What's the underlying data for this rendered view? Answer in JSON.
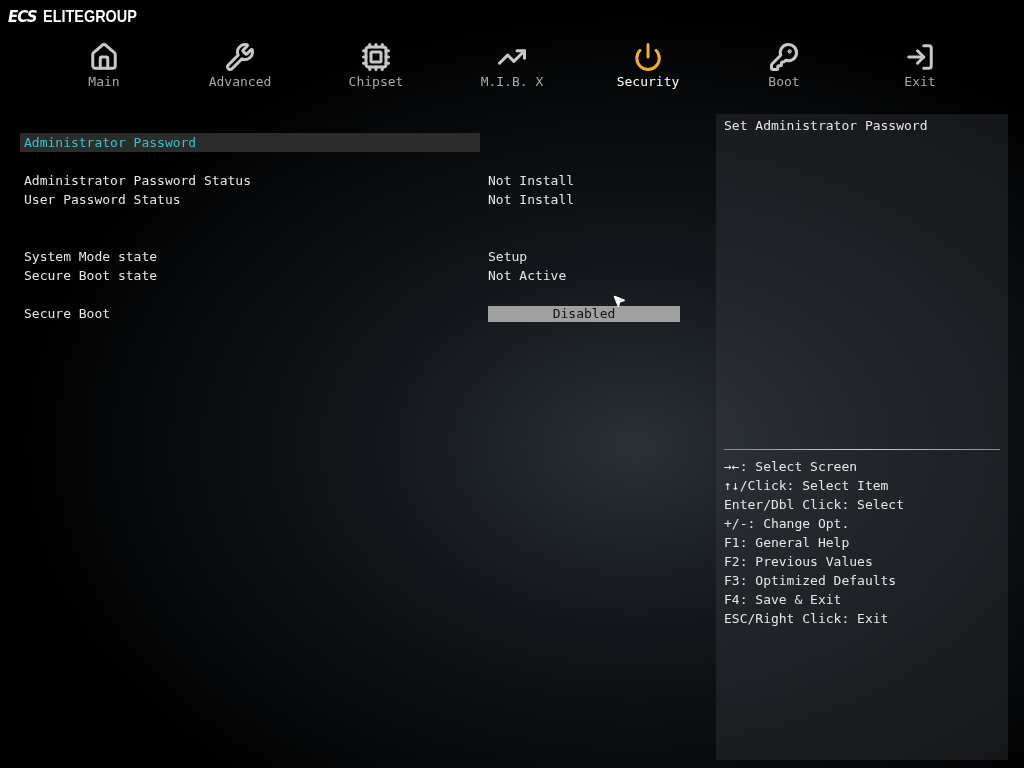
{
  "logo": {
    "mark": "ECS",
    "text": "ELITEGROUP"
  },
  "tabs": [
    {
      "label": "Main",
      "selected": false
    },
    {
      "label": "Advanced",
      "selected": false
    },
    {
      "label": "Chipset",
      "selected": false
    },
    {
      "label": "M.I.B. X",
      "selected": false
    },
    {
      "label": "Security",
      "selected": true
    },
    {
      "label": "Boot",
      "selected": false
    },
    {
      "label": "Exit",
      "selected": false
    }
  ],
  "items": [
    {
      "kind": "heading",
      "label": "Administrator Password",
      "selected": true
    },
    {
      "kind": "spacer"
    },
    {
      "kind": "info",
      "label": "Administrator Password Status",
      "value": "Not Install"
    },
    {
      "kind": "info",
      "label": "User Password Status",
      "value": "Not Install"
    },
    {
      "kind": "spacer"
    },
    {
      "kind": "spacer"
    },
    {
      "kind": "info",
      "label": "System Mode state",
      "value": "Setup"
    },
    {
      "kind": "info",
      "label": "Secure Boot state",
      "value": "Not Active"
    },
    {
      "kind": "spacer"
    },
    {
      "kind": "option",
      "label": "Secure Boot",
      "value": "Disabled",
      "selected": false
    }
  ],
  "help": {
    "text": "Set Administrator Password",
    "keys": [
      "→←: Select Screen",
      "↑↓/Click: Select Item",
      "Enter/Dbl Click: Select",
      "+/-: Change Opt.",
      "F1: General Help",
      "F2: Previous Values",
      "F3: Optimized Defaults",
      "F4: Save & Exit",
      "ESC/Right Click: Exit"
    ]
  }
}
